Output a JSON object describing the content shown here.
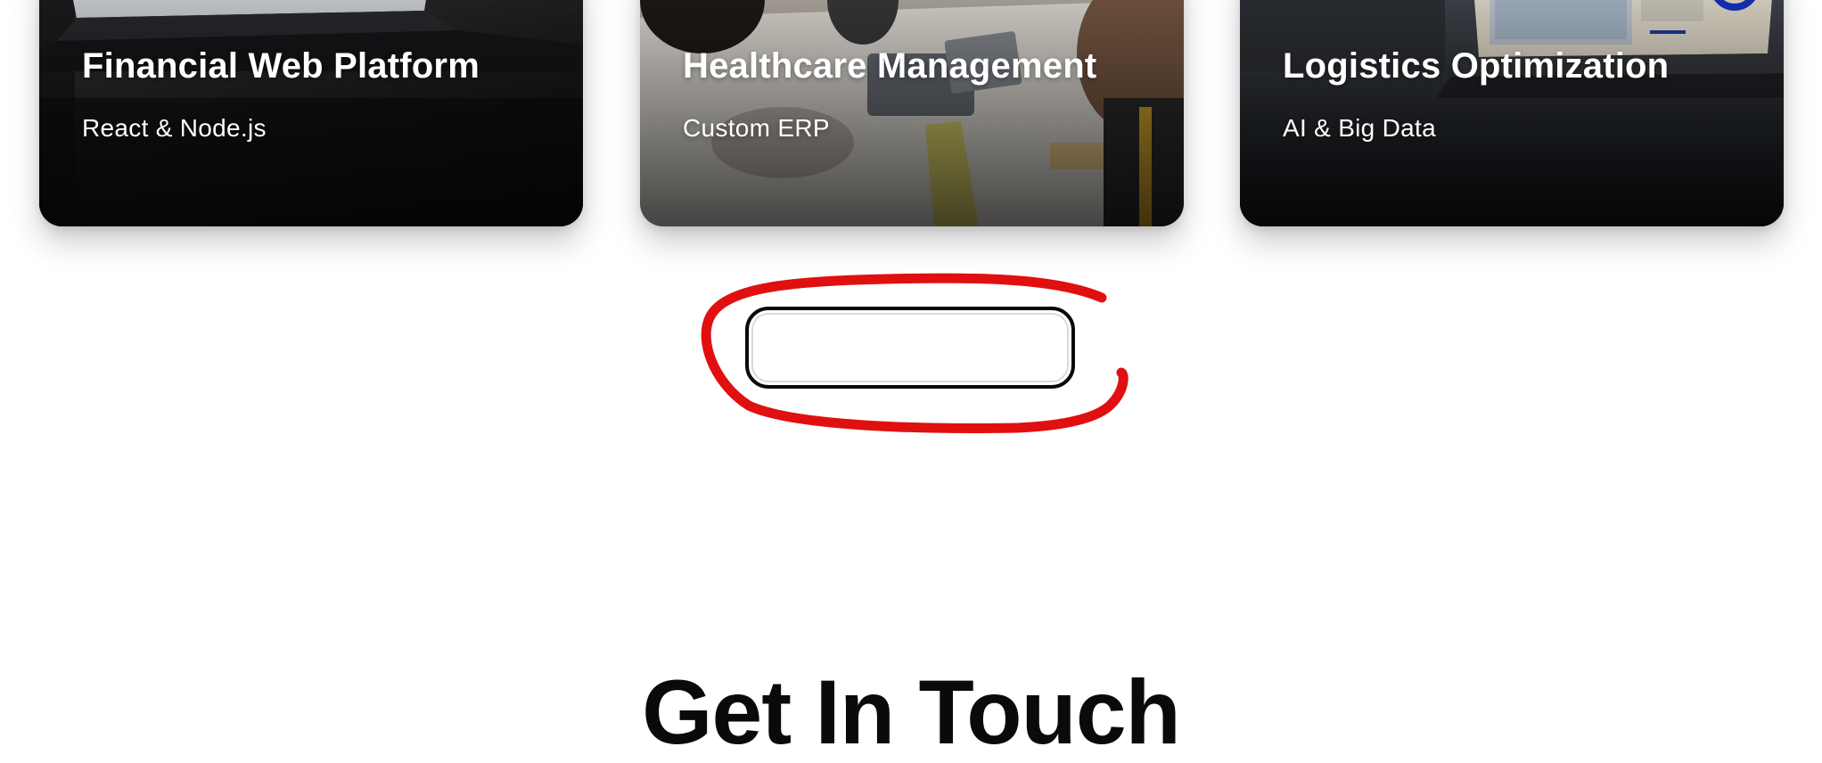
{
  "projects": [
    {
      "title": "Financial Web Platform",
      "subtitle": "React & Node.js",
      "image": "laptop-dashboard-photo"
    },
    {
      "title": "Healthcare Management",
      "subtitle": "Custom ERP",
      "image": "team-meeting-photo"
    },
    {
      "title": "Logistics Optimization",
      "subtitle": "AI & Big Data",
      "image": "laptop-analytics-photo"
    }
  ],
  "view_button": {
    "label": ""
  },
  "contact": {
    "heading": "Get In Touch"
  },
  "annotation": {
    "color": "#e01010",
    "shape": "hand-drawn-circle"
  }
}
